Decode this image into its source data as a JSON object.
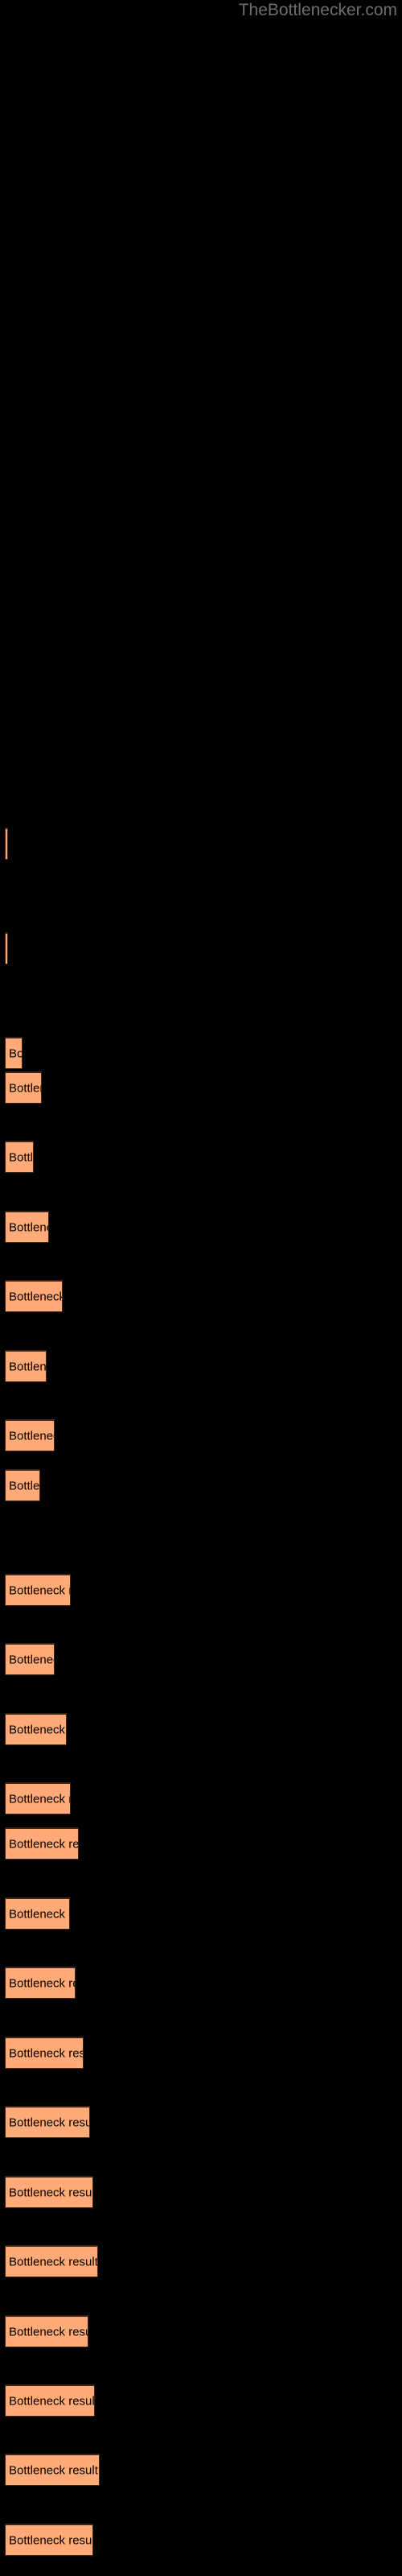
{
  "header": {
    "site_title": "TheBottlenecker.com",
    "title_color": "#6e6e6e"
  },
  "theme": {
    "background": "#000000",
    "bar_fill": "#ffaa77",
    "bar_border": "#3d2216",
    "label_color": "#000000"
  },
  "chart_data": {
    "type": "bar",
    "orientation": "horizontal",
    "title": "",
    "subtitle": "",
    "xlabel": "",
    "ylabel": "",
    "grid": false,
    "legend": null,
    "xlim": [
      0,
      500
    ],
    "bar_label_text": "Bottleneck result",
    "categories": [
      "Bottleneck result",
      "Bottleneck result",
      "Bottleneck result",
      "Bottleneck result",
      "Bottleneck result",
      "Bottleneck result",
      "Bottleneck result",
      "Bottleneck result",
      "Bottleneck result",
      "Bottleneck result",
      "Bottleneck result",
      "Bottleneck result",
      "Bottleneck result",
      "Bottleneck result",
      "Bottleneck result",
      "Bottleneck result",
      "Bottleneck result",
      "Bottleneck result",
      "Bottleneck result",
      "Bottleneck result",
      "Bottleneck result",
      "Bottleneck result"
    ],
    "values": [
      4,
      4,
      22,
      46,
      36,
      55,
      72,
      52,
      62,
      44,
      82,
      62,
      77,
      82,
      92,
      81,
      88,
      98,
      106,
      110,
      116,
      104
    ],
    "bars": [
      {
        "index": 0,
        "label": "Bottleneck result",
        "y": 1028,
        "width": 4,
        "height": 40
      },
      {
        "index": 1,
        "label": "Bottleneck result",
        "y": 1158,
        "width": 4,
        "height": 40
      },
      {
        "index": 2,
        "label": "Bottleneck result",
        "y": 1288,
        "width": 22,
        "height": 40
      },
      {
        "index": 3,
        "label": "Bottleneck result",
        "y": 1331,
        "width": 46,
        "height": 40
      },
      {
        "index": 4,
        "label": "Bottleneck result",
        "y": 1417,
        "width": 36,
        "height": 40
      },
      {
        "index": 5,
        "label": "Bottleneck result",
        "y": 1504,
        "width": 55,
        "height": 40
      },
      {
        "index": 6,
        "label": "Bottleneck result",
        "y": 1590,
        "width": 72,
        "height": 40
      },
      {
        "index": 7,
        "label": "Bottleneck result",
        "y": 1677,
        "width": 52,
        "height": 40
      },
      {
        "index": 8,
        "label": "Bottleneck result",
        "y": 1763,
        "width": 62,
        "height": 40
      },
      {
        "index": 9,
        "label": "Bottleneck result",
        "y": 1825,
        "width": 44,
        "height": 40
      },
      {
        "index": 10,
        "label": "Bottleneck result",
        "y": 1955,
        "width": 82,
        "height": 40
      },
      {
        "index": 11,
        "label": "Bottleneck result",
        "y": 2041,
        "width": 62,
        "height": 40
      },
      {
        "index": 12,
        "label": "Bottleneck result",
        "y": 2128,
        "width": 77,
        "height": 40
      },
      {
        "index": 13,
        "label": "Bottleneck result",
        "y": 2214,
        "width": 82,
        "height": 40
      },
      {
        "index": 14,
        "label": "Bottleneck result",
        "y": 2270,
        "width": 92,
        "height": 40
      },
      {
        "index": 15,
        "label": "Bottleneck result",
        "y": 2357,
        "width": 81,
        "height": 40
      },
      {
        "index": 16,
        "label": "Bottleneck result",
        "y": 2443,
        "width": 88,
        "height": 40
      },
      {
        "index": 17,
        "label": "Bottleneck result",
        "y": 2530,
        "width": 98,
        "height": 40
      },
      {
        "index": 18,
        "label": "Bottleneck result",
        "y": 2616,
        "width": 106,
        "height": 40
      },
      {
        "index": 19,
        "label": "Bottleneck result",
        "y": 2703,
        "width": 110,
        "height": 40
      },
      {
        "index": 20,
        "label": "Bottleneck result",
        "y": 2789,
        "width": 116,
        "height": 40
      },
      {
        "index": 21,
        "label": "Bottleneck result",
        "y": 2876,
        "width": 104,
        "height": 40
      },
      {
        "index": 22,
        "label": "Bottleneck result",
        "y": 2962,
        "width": 112,
        "height": 40
      },
      {
        "index": 23,
        "label": "Bottleneck result",
        "y": 3048,
        "width": 118,
        "height": 40
      },
      {
        "index": 24,
        "label": "Bottleneck result",
        "y": 3135,
        "width": 110,
        "height": 40
      }
    ]
  }
}
